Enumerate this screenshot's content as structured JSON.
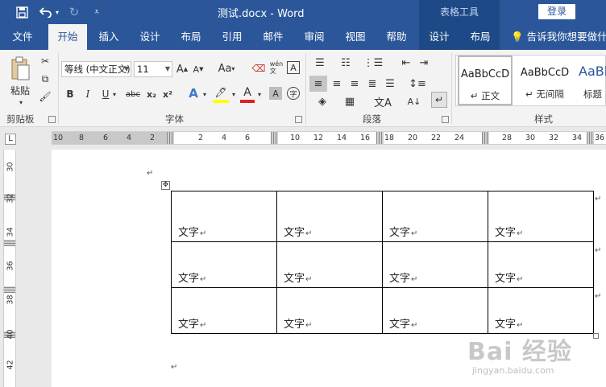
{
  "titlebar": {
    "document_title": "测试.docx  -  Word",
    "contextual_title": "表格工具",
    "login_label": "登录"
  },
  "tabs": {
    "items": [
      "文件",
      "开始",
      "插入",
      "设计",
      "布局",
      "引用",
      "邮件",
      "审阅",
      "视图",
      "帮助"
    ],
    "context_items": [
      "设计",
      "布局"
    ],
    "tellme": "告诉我你想要做什么"
  },
  "ribbon": {
    "clipboard": {
      "paste_label": "粘贴",
      "group_label": "剪贴板"
    },
    "font": {
      "font_name": "等线 (中文正文)",
      "font_size": "11",
      "group_label": "字体",
      "buttons": [
        "B",
        "I",
        "U",
        "abc",
        "x₂",
        "x²",
        "A",
        "Aa"
      ]
    },
    "paragraph": {
      "group_label": "段落"
    },
    "styles": {
      "group_label": "样式",
      "items": [
        {
          "sample": "AaBbCcD",
          "name": "↵ 正文"
        },
        {
          "sample": "AaBbCcD",
          "name": "↵ 无间隔"
        },
        {
          "sample": "AaBl",
          "name": "标题"
        }
      ]
    }
  },
  "ruler": {
    "corner_label": "L",
    "h_ticks_left": [
      "10",
      "8",
      "6",
      "4",
      "2"
    ],
    "h_ticks_main": [
      "2",
      "4",
      "6",
      "10",
      "12",
      "14",
      "16",
      "18",
      "20",
      "22",
      "24",
      "28",
      "30",
      "32",
      "34",
      "36"
    ],
    "v_ticks": [
      "30",
      "32",
      "34",
      "36",
      "38",
      "40",
      "42"
    ]
  },
  "document": {
    "paragraph_mark": "↵",
    "table": {
      "rows": [
        [
          "文字",
          "文字",
          "文字",
          "文字"
        ],
        [
          "文字",
          "文字",
          "文字",
          "文字"
        ],
        [
          "文字",
          "文字",
          "文字",
          "文字"
        ]
      ]
    }
  },
  "colors": {
    "title_blue": "#2b579a",
    "context_blue": "#1d4a86",
    "ribbon_bg": "#f3f3f3"
  },
  "watermark": {
    "text": "Bai 经验",
    "url_text": "jingyan.baidu.com"
  }
}
